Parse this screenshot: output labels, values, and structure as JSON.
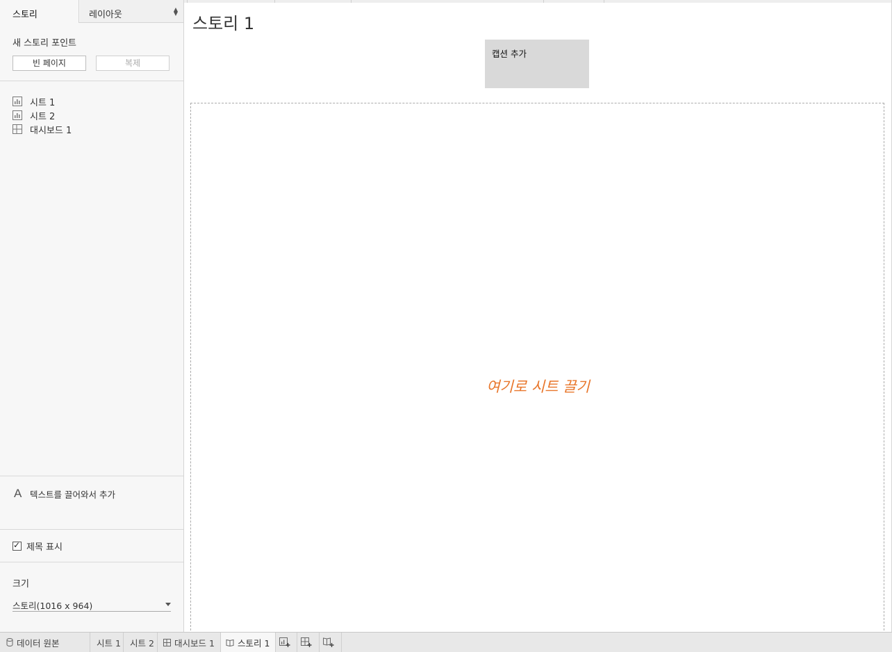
{
  "panel": {
    "tabs": {
      "story": "스토리",
      "layout": "레이아웃"
    },
    "new_story_point": {
      "title": "새 스토리 포인트",
      "blank_button": "빈 페이지",
      "duplicate_button": "복제"
    },
    "sheets": [
      {
        "label": "시트 1",
        "icon": "worksheet-icon"
      },
      {
        "label": "시트 2",
        "icon": "worksheet-icon"
      },
      {
        "label": "대시보드 1",
        "icon": "dashboard-icon"
      }
    ],
    "text_object": {
      "icon_glyph": "A",
      "label": "텍스트를 끌어와서 추가"
    },
    "show_title": {
      "label": "제목 표시",
      "checked": true
    },
    "size": {
      "title": "크기",
      "value": "스토리(1016 x 964)"
    }
  },
  "main": {
    "title": "스토리 1",
    "caption_placeholder": "캡션 추가",
    "drop_hint": "여기로 시트 끌기",
    "drop_hint_color": "#e8762b"
  },
  "bottom_tabs": [
    {
      "label": "데이터 원본",
      "icon": "database-icon"
    },
    {
      "label": "시트 1",
      "icon": ""
    },
    {
      "label": "시트 2",
      "icon": ""
    },
    {
      "label": "대시보드 1",
      "icon": "dashboard-icon"
    },
    {
      "label": "스토리 1",
      "icon": "story-icon",
      "active": true
    },
    {
      "label": "",
      "icon": "new-worksheet-icon"
    },
    {
      "label": "",
      "icon": "new-dashboard-icon"
    },
    {
      "label": "",
      "icon": "new-story-icon"
    }
  ]
}
